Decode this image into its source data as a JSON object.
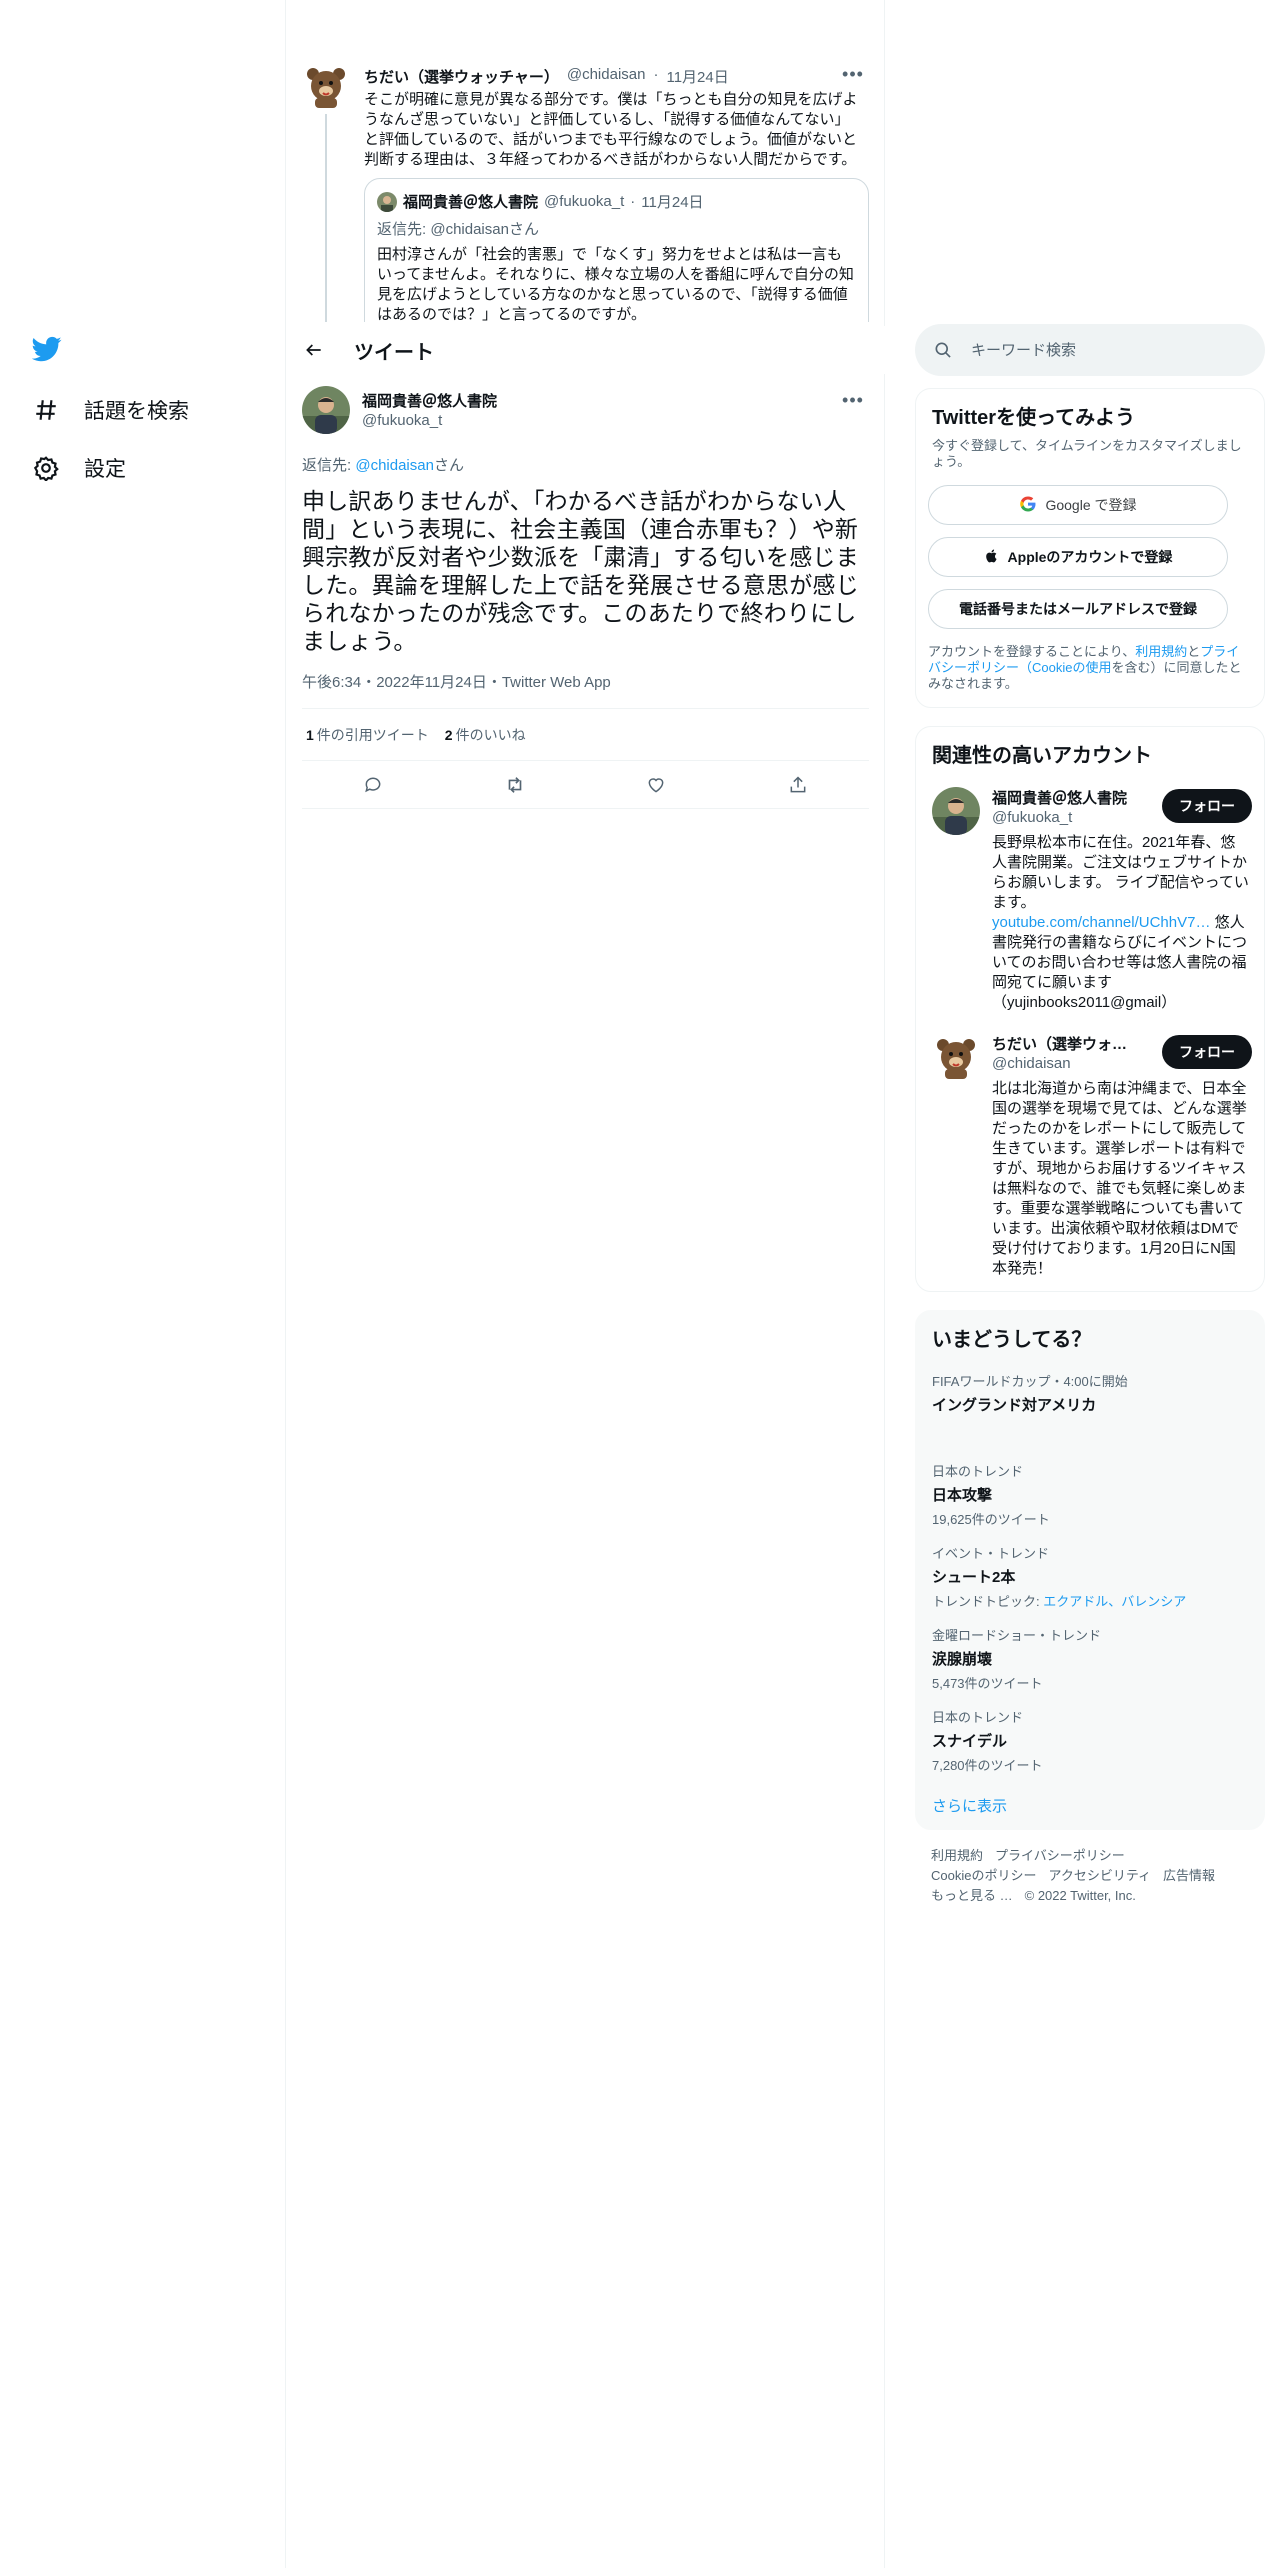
{
  "nav": {
    "logo": "twitter-bird-icon",
    "items": [
      {
        "icon": "hashtag-icon",
        "label": "話題を検索"
      },
      {
        "icon": "gear-icon",
        "label": "設定"
      }
    ]
  },
  "upstream_tweet": {
    "name": "ちだい（選挙ウォッチャー）",
    "handle": "@chidaisan",
    "date": "11月24日",
    "text": "そこが明確に意見が異なる部分です。僕は「ちっとも自分の知見を広げようなんざ思っていない」と評価しているし、「説得する価値なんてない」と評価しているので、話がいつまでも平行線なのでしょう。価値がないと判断する理由は、３年経ってわかるべき話がわからない人間だからです。",
    "quote": {
      "name": "福岡貴善＠悠人書院",
      "handle": "@fukuoka_t",
      "date": "11月24日",
      "reply_prefix": "返信先: ",
      "reply_to": "@chidaisan",
      "reply_suffix": "さん",
      "text": "田村淳さんが「社会的害悪」で「なくす」努力をせよとは私は一言もいってませんよ。それなりに、様々な立場の人を番組に呼んで自分の知見を広げようとしている方なのかなと思っているので、「説得する価値はあるのでは？」と言ってるのですが。"
    }
  },
  "header": {
    "title": "ツイート"
  },
  "main_tweet": {
    "name": "福岡貴善＠悠人書院",
    "handle": "@fukuoka_t",
    "reply_prefix": "返信先: ",
    "reply_to": "@chidaisan",
    "reply_suffix": "さん",
    "text": "申し訳ありませんが、「わかるべき話がわからない人間」という表現に、社会主義国（連合赤軍も？）や新興宗教が反対者や少数派を「粛清」する匂いを感じました。異論を理解した上で話を発展させる意思が感じられなかったのが残念です。このあたりで終わりにしましょう。",
    "meta": "午後6:34・2022年11月24日・Twitter Web App",
    "stats": {
      "quotes_count": "1",
      "quotes_label": "件の引用ツイート",
      "likes_count": "2",
      "likes_label": "件のいいね"
    }
  },
  "search": {
    "placeholder": "キーワード検索"
  },
  "signup": {
    "title": "Twitterを使ってみよう",
    "subtitle": "今すぐ登録して、タイムラインをカスタマイズしましょう。",
    "google": "Google で登録",
    "apple": "Appleのアカウントで登録",
    "phone": "電話番号またはメールアドレスで登録",
    "legal_prefix": "アカウントを登録することにより、",
    "terms": "利用規約",
    "and": "と",
    "privacy": "プライバシーポリシー（Cookieの使用",
    "legal_suffix": "を含む）に同意したとみなされます。"
  },
  "related": {
    "title": "関連性の高いアカウント",
    "follow_label": "フォロー",
    "accounts": [
      {
        "name": "福岡貴善＠悠人書院",
        "handle": "@fukuoka_t",
        "bio_pre": "長野県松本市に在住。2021年春、悠人書院開業。ご注文はウェブサイトからお願いします。 ライブ配信やっています。",
        "bio_link": "youtube.com/channel/UChhV7…",
        "bio_post": " 悠人書院発行の書籍ならびにイベントについてのお問い合わせ等は悠人書院の福岡宛てに願います （yujinbooks2011@gmail）"
      },
      {
        "name": "ちだい（選挙ウォッチャー）",
        "handle": "@chidaisan",
        "bio": "北は北海道から南は沖縄まで、日本全国の選挙を現場で見ては、どんな選挙だったのかをレポートにして販売して生きています。選挙レポートは有料ですが、現地からお届けするツイキャスは無料なので、誰でも気軽に楽しめます。重要な選挙戦略についても書いています。出演依頼や取材依頼はDMで受け付けております。1月20日にN国本発売！"
      }
    ]
  },
  "trends": {
    "title": "いまどうしてる？",
    "items": [
      {
        "context": "FIFAワールドカップ・4:00に開始",
        "title": "イングランド対アメリカ",
        "count": ""
      },
      {
        "context": "日本のトレンド",
        "title": "日本攻撃",
        "count": "19,625件のツイート"
      },
      {
        "context": "イベント・トレンド",
        "title": "シュート2本",
        "count_prefix": "トレンドトピック: ",
        "count_links": "エクアドル、バレンシア"
      },
      {
        "context": "金曜ロードショー・トレンド",
        "title": "涙腺崩壊",
        "count": "5,473件のツイート"
      },
      {
        "context": "日本のトレンド",
        "title": "スナイデル",
        "count": "7,280件のツイート"
      }
    ],
    "show_more": "さらに表示"
  },
  "footer": {
    "links_row1": [
      "利用規約",
      "プライバシーポリシー"
    ],
    "links_row2": [
      "Cookieのポリシー",
      "アクセシビリティ",
      "広告情報"
    ],
    "more": "もっと見る …",
    "copyright": "© 2022 Twitter, Inc."
  },
  "colors": {
    "accent": "#1d9bf0",
    "text": "#0f1419",
    "muted": "#536471",
    "border": "#eff3f4"
  }
}
